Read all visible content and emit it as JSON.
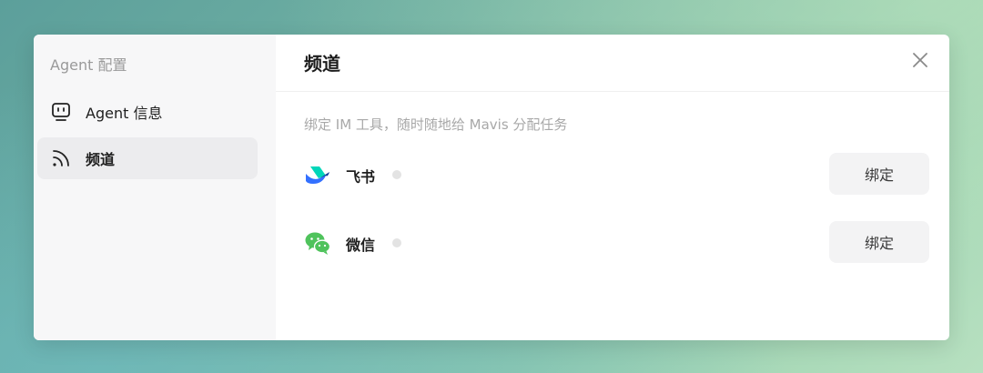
{
  "sidebar": {
    "title": "Agent 配置",
    "items": [
      {
        "label": "Agent 信息",
        "icon": "robot-icon",
        "active": false
      },
      {
        "label": "频道",
        "icon": "rss-icon",
        "active": true
      }
    ]
  },
  "main": {
    "title": "频道",
    "description": "绑定 IM 工具，随时随地给 Mavis 分配任务",
    "channels": [
      {
        "name": "飞书",
        "icon": "feishu-logo-icon",
        "status": "unbound",
        "action": "绑定"
      },
      {
        "name": "微信",
        "icon": "wechat-logo-icon",
        "status": "unbound",
        "action": "绑定"
      }
    ]
  },
  "colors": {
    "sidebar_bg": "#f7f7f8",
    "active_item_bg": "#ececee",
    "wechat_green": "#4fc35c",
    "feishu_blue": "#3370ff",
    "feishu_teal": "#00d6b9"
  }
}
